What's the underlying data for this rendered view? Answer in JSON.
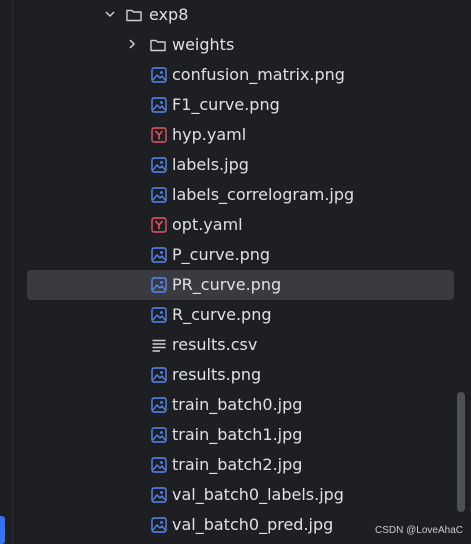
{
  "project_tree": {
    "folder": {
      "name": "exp8",
      "expanded": true
    },
    "subfolder": {
      "name": "weights",
      "expanded": false
    },
    "files": [
      {
        "name": "confusion_matrix.png",
        "icon": "image-file-icon"
      },
      {
        "name": "F1_curve.png",
        "icon": "image-file-icon"
      },
      {
        "name": "hyp.yaml",
        "icon": "yaml-file-icon"
      },
      {
        "name": "labels.jpg",
        "icon": "image-file-icon"
      },
      {
        "name": "labels_correlogram.jpg",
        "icon": "image-file-icon"
      },
      {
        "name": "opt.yaml",
        "icon": "yaml-file-icon"
      },
      {
        "name": "P_curve.png",
        "icon": "image-file-icon"
      },
      {
        "name": "PR_curve.png",
        "icon": "image-file-icon",
        "selected": true
      },
      {
        "name": "R_curve.png",
        "icon": "image-file-icon"
      },
      {
        "name": "results.csv",
        "icon": "text-file-icon"
      },
      {
        "name": "results.png",
        "icon": "image-file-icon"
      },
      {
        "name": "train_batch0.jpg",
        "icon": "image-file-icon"
      },
      {
        "name": "train_batch1.jpg",
        "icon": "image-file-icon"
      },
      {
        "name": "train_batch2.jpg",
        "icon": "image-file-icon"
      },
      {
        "name": "val_batch0_labels.jpg",
        "icon": "image-file-icon"
      },
      {
        "name": "val_batch0_pred.jpg",
        "icon": "image-file-icon"
      }
    ]
  },
  "watermark": "CSDN @LoveAhaC",
  "colors": {
    "background": "#1e1f22",
    "selection": "#393b40",
    "text": "#dfe1e5",
    "image_icon": "#548af7",
    "yaml_icon": "#e55765",
    "folder_icon": "#ced0d6"
  }
}
